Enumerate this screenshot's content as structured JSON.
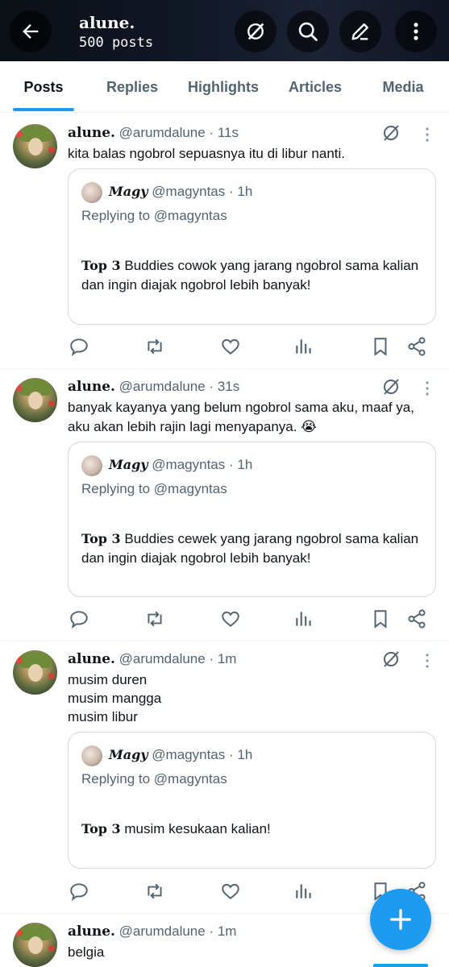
{
  "header": {
    "title": "alune.",
    "subtitle": "500 posts",
    "icons": [
      "back-arrow-icon",
      "grok-icon",
      "search-icon",
      "compose-icon",
      "more-vertical-icon"
    ]
  },
  "tabs": [
    {
      "label": "Posts",
      "active": true
    },
    {
      "label": "Replies",
      "active": false
    },
    {
      "label": "Highlights",
      "active": false
    },
    {
      "label": "Articles",
      "active": false
    },
    {
      "label": "Media",
      "active": false
    }
  ],
  "posts": [
    {
      "name": "alune.",
      "handle": "@arumdalune",
      "time": "· 11s",
      "text": "kita balas ngobrol sepuasnya itu di libur nanti.",
      "quote": {
        "name": "Magy",
        "handle": "@magyntas",
        "time": "· 1h",
        "replying": "Replying to @magyntas",
        "bold": "Top 3",
        "text": " Buddies cowok yang jarang ngobrol sama kalian dan ingin diajak ngobrol lebih banyak!"
      }
    },
    {
      "name": "alune.",
      "handle": "@arumdalune",
      "time": "· 31s",
      "text": "banyak kayanya yang belum ngobrol sama aku, maaf ya, aku akan lebih rajin lagi menyapanya. 😭",
      "quote": {
        "name": "Magy",
        "handle": "@magyntas",
        "time": "· 1h",
        "replying": "Replying to @magyntas",
        "bold": "Top 3",
        "text": " Buddies cewek yang jarang ngobrol sama kalian dan ingin diajak ngobrol lebih banyak!"
      }
    },
    {
      "name": "alune.",
      "handle": "@arumdalune",
      "time": "· 1m",
      "text": "musim duren\nmusim mangga\nmusim libur",
      "quote": {
        "name": "Magy",
        "handle": "@magyntas",
        "time": "· 1h",
        "replying": "Replying to @magyntas",
        "bold": "Top 3",
        "text": " musim kesukaan kalian!"
      }
    },
    {
      "name": "alune.",
      "handle": "@arumdalune",
      "time": "· 1m",
      "text": "belgia"
    }
  ],
  "fab": {
    "icon": "plus-icon"
  },
  "colors": {
    "accent": "#1d9bf0",
    "secondary_text": "#536471",
    "border": "#cfd9de"
  }
}
